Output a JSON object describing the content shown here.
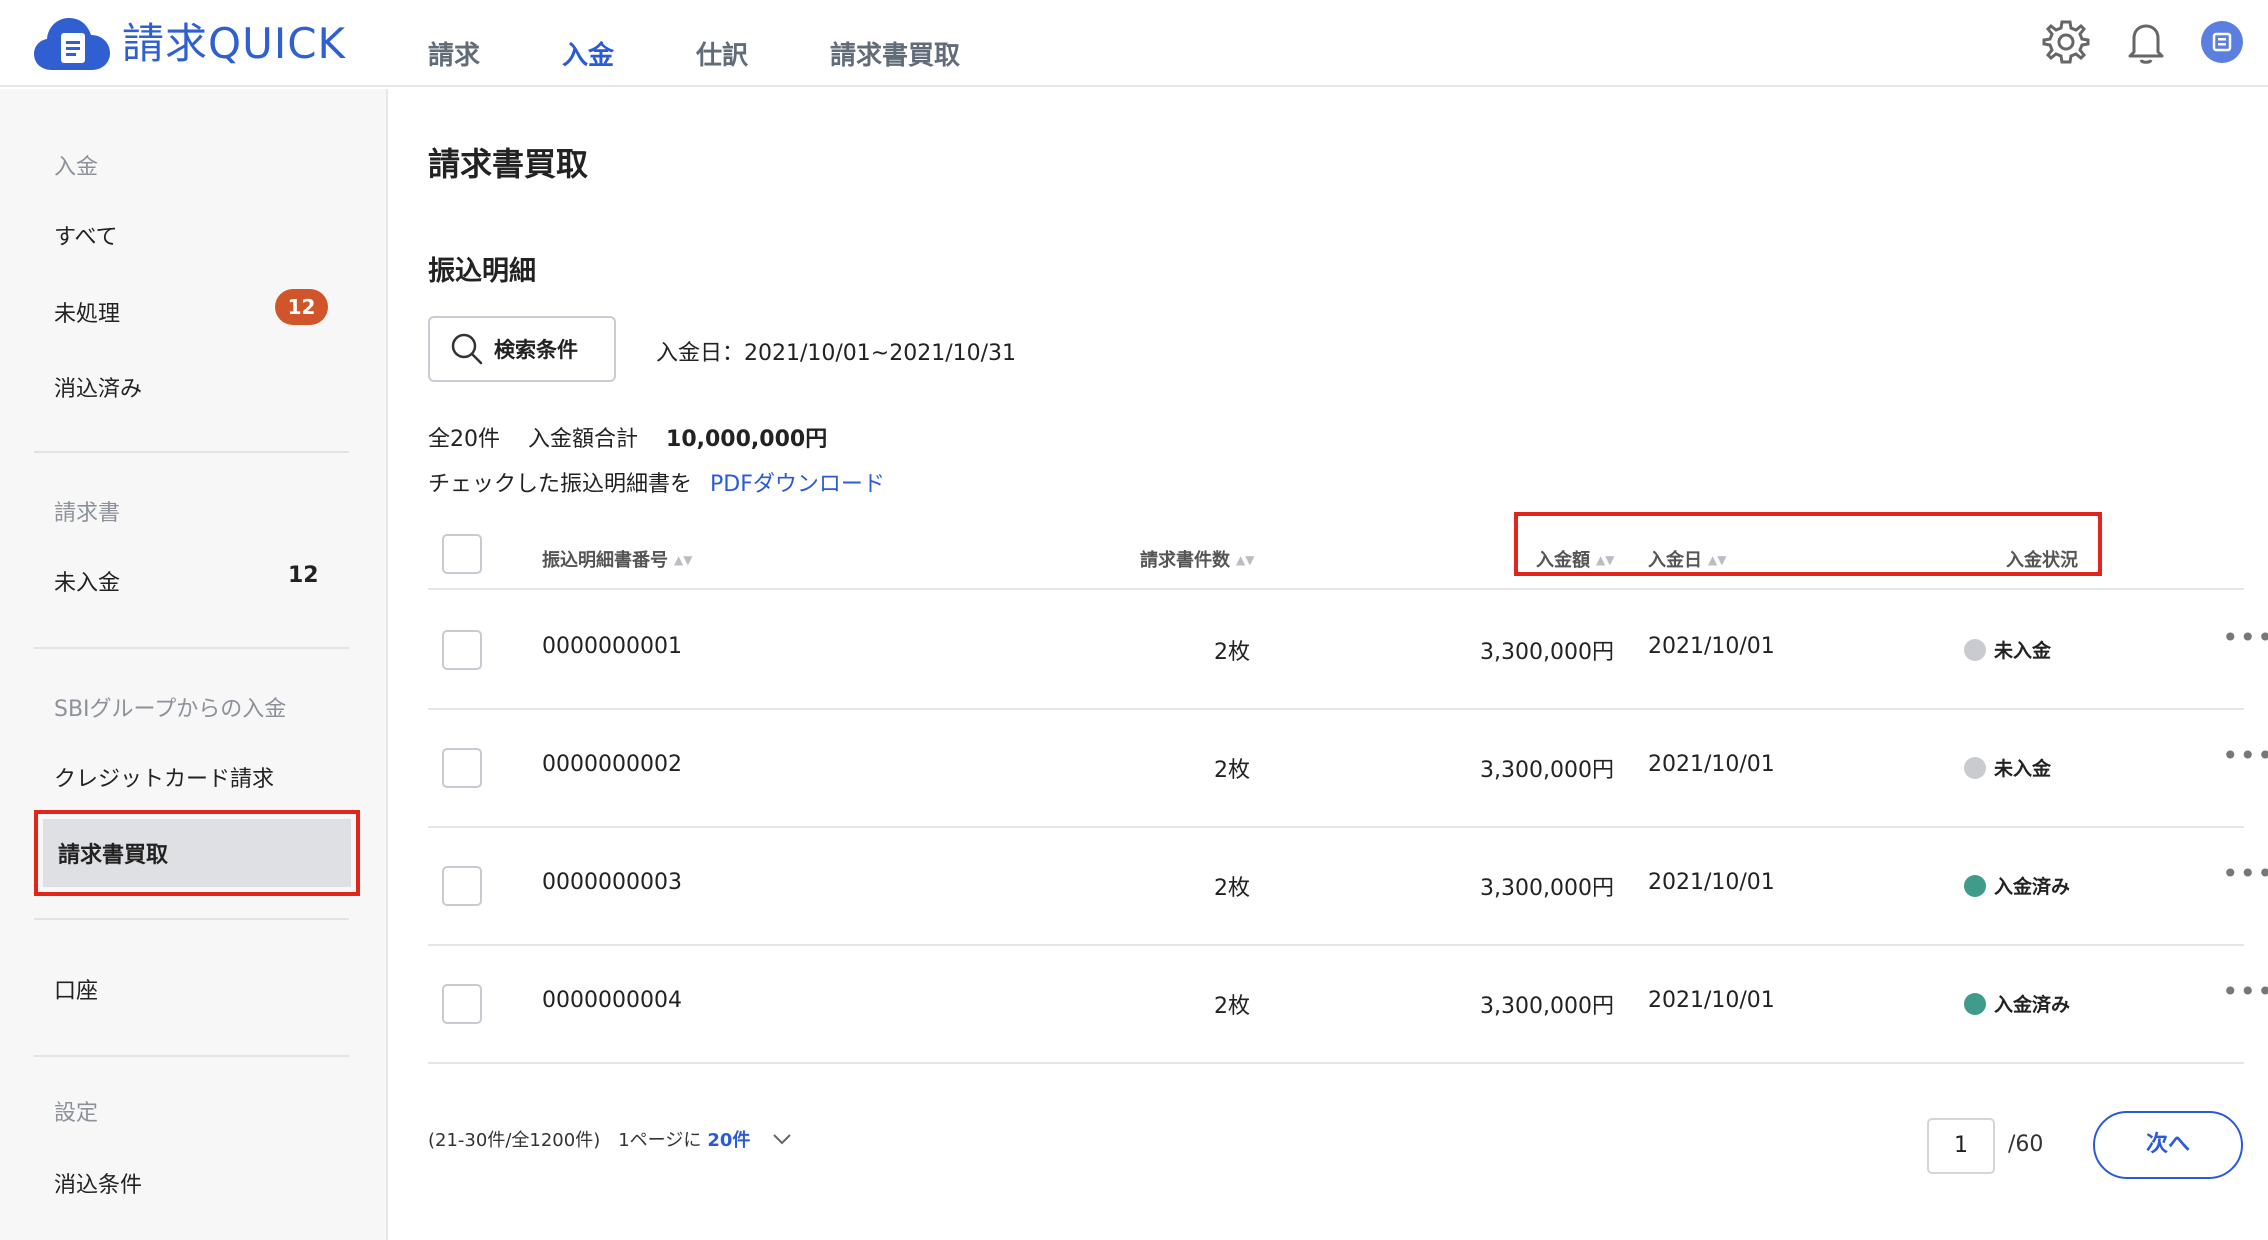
{
  "app": {
    "name_jp": "請求",
    "name_latin": "QUICK"
  },
  "topnav": [
    {
      "label": "請求",
      "active": false
    },
    {
      "label": "入金",
      "active": true
    },
    {
      "label": "仕訳",
      "active": false
    },
    {
      "label": "請求書買取",
      "active": false
    }
  ],
  "icons": {
    "settings": "gear-icon",
    "notifications": "bell-icon",
    "account": "avatar"
  },
  "sidebar": {
    "sections": {
      "payments": "入金",
      "invoices": "請求書",
      "sbi": "SBIグループからの入金",
      "settings": "設定"
    },
    "items": {
      "all": "すべて",
      "unprocessed": "未処理",
      "unprocessed_badge": "12",
      "cleared": "消込済み",
      "unpaid": "未入金",
      "unpaid_count": "12",
      "credit_card": "クレジットカード請求",
      "factoring": "請求書買取",
      "account": "口座",
      "clear_conditions": "消込条件"
    }
  },
  "main": {
    "title": "請求書買取",
    "subtitle": "振込明細",
    "search_button": "検索条件",
    "date_range": "入金日：2021/10/01~2021/10/31",
    "total_count": "全20件",
    "total_amount_label": "入金額合計",
    "total_amount": "10,000,000円",
    "pdf_prefix": "チェックした振込明細書を",
    "pdf_link": "PDFダウンロード"
  },
  "table": {
    "headers": {
      "number": "振込明細書番号",
      "invoice_count": "請求書件数",
      "amount": "入金額",
      "date": "入金日",
      "status": "入金状況"
    },
    "rows": [
      {
        "number": "0000000001",
        "invoice_count": "2枚",
        "amount": "3,300,000円",
        "date": "2021/10/01",
        "status": "未入金",
        "status_color": "#c9cbd0"
      },
      {
        "number": "0000000002",
        "invoice_count": "2枚",
        "amount": "3,300,000円",
        "date": "2021/10/01",
        "status": "未入金",
        "status_color": "#c9cbd0"
      },
      {
        "number": "0000000003",
        "invoice_count": "2枚",
        "amount": "3,300,000円",
        "date": "2021/10/01",
        "status": "入金済み",
        "status_color": "#3f9c8a"
      },
      {
        "number": "0000000004",
        "invoice_count": "2枚",
        "amount": "3,300,000円",
        "date": "2021/10/01",
        "status": "入金済み",
        "status_color": "#3f9c8a"
      }
    ]
  },
  "pagination": {
    "range": "(21-30件/全1200件)",
    "per_page_label": "1ページに",
    "per_page_value": "20件",
    "current_page": "1",
    "total_pages": "/60",
    "next_label": "次へ"
  },
  "colors": {
    "accent": "#2a5bd7",
    "badge": "#d0552a",
    "highlight": "#e1251b"
  }
}
